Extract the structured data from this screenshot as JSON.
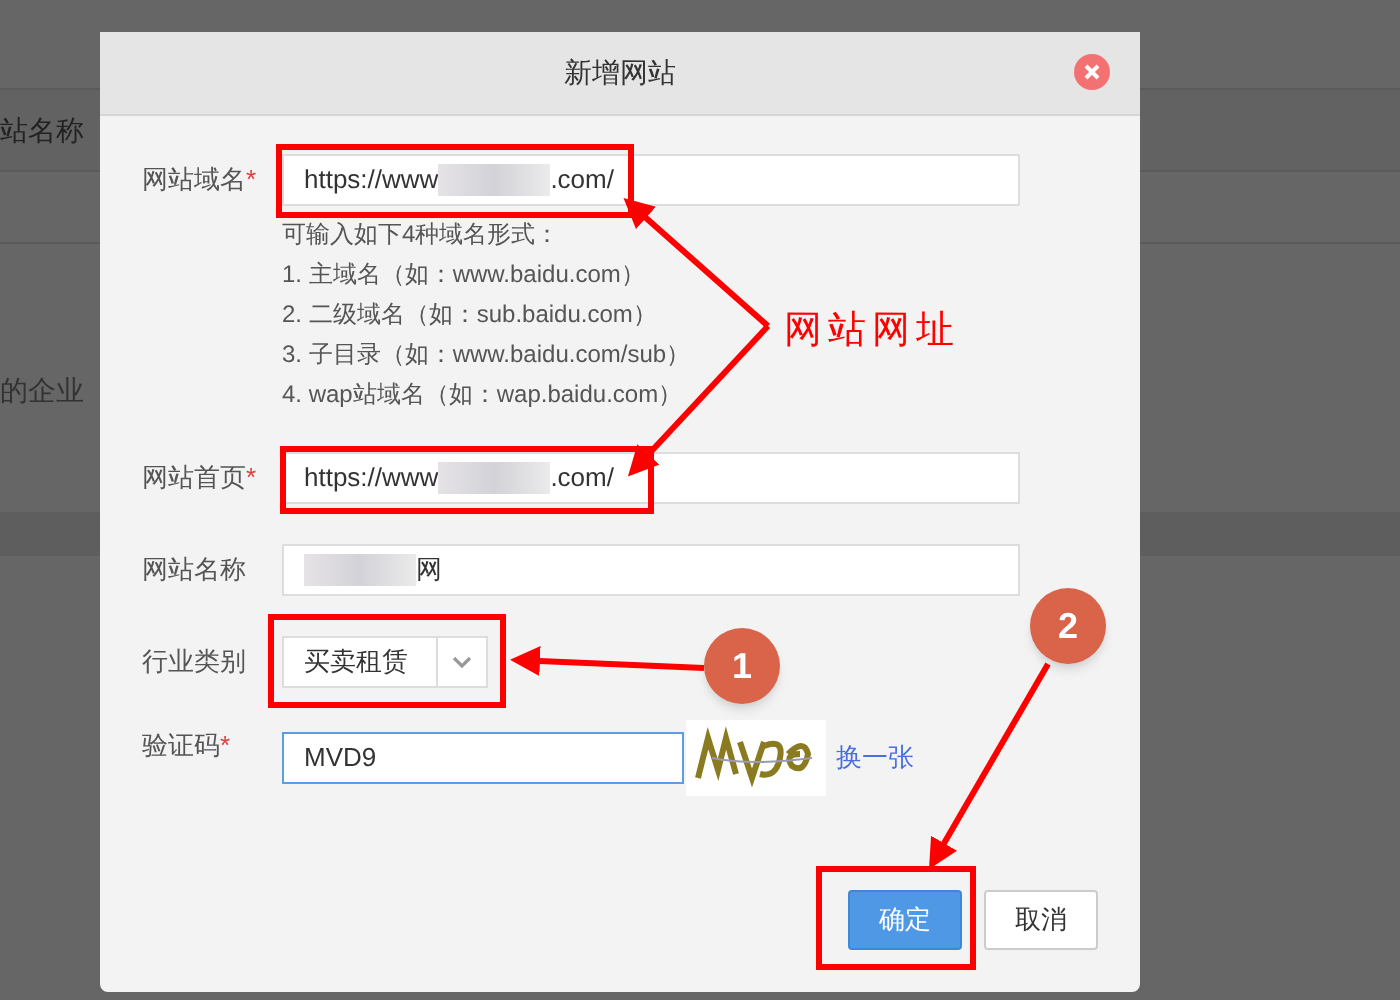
{
  "background": {
    "header_left": "站名称",
    "row_text": "的企业"
  },
  "dialog": {
    "title": "新增网站",
    "fields": [
      {
        "kind": "text",
        "label": "网站域名",
        "required_mark": "*",
        "value_prefix": "https://www",
        "value_suffix": ".com/",
        "redacted": true,
        "focused": false,
        "hints": [
          "可输入如下4种域名形式：",
          "1. 主域名（如：www.baidu.com）",
          "2. 二级域名（如：sub.baidu.com）",
          "3. 子目录（如：www.baidu.com/sub）",
          "4. wap站域名（如：wap.baidu.com）"
        ]
      },
      {
        "kind": "text",
        "label": "网站首页",
        "required_mark": "*",
        "value_prefix": "https://www",
        "value_suffix": ".com/",
        "redacted": true,
        "focused": false
      },
      {
        "kind": "text",
        "label": "网站名称",
        "value_suffix": "网",
        "redacted": true,
        "focused": false
      },
      {
        "kind": "select",
        "label": "行业类别",
        "value": "买卖租赁"
      },
      {
        "kind": "captcha",
        "label": "验证码",
        "required_mark": "*",
        "value": "MVD9",
        "focused": true,
        "refresh_link": "换一张"
      }
    ],
    "buttons": [
      {
        "label": "确定",
        "primary": true
      },
      {
        "label": "取消",
        "primary": false
      }
    ]
  },
  "annotations": {
    "label": "网站网址",
    "markers": [
      "1",
      "2"
    ]
  }
}
